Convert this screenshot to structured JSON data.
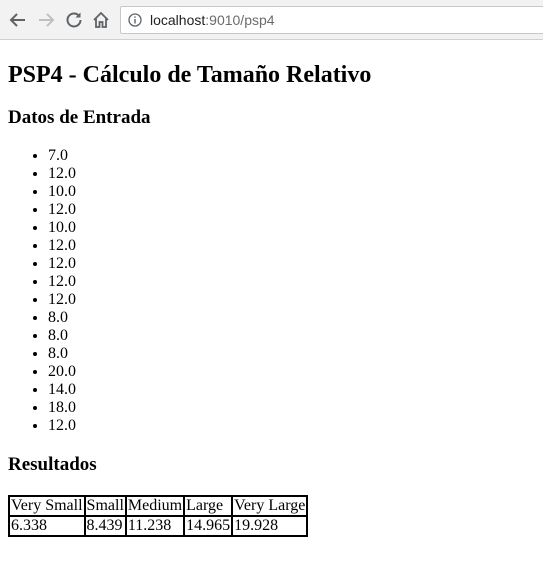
{
  "browser": {
    "url_host": "localhost",
    "url_rest": ":9010/psp4",
    "back_icon": "arrow-left-icon",
    "forward_icon": "arrow-right-icon",
    "reload_icon": "reload-icon",
    "home_icon": "home-icon",
    "info_icon": "info-icon"
  },
  "page": {
    "title": "PSP4 - Cálculo de Tamaño Relativo",
    "input_heading": "Datos de Entrada",
    "inputs": [
      "7.0",
      "12.0",
      "10.0",
      "12.0",
      "10.0",
      "12.0",
      "12.0",
      "12.0",
      "12.0",
      "8.0",
      "8.0",
      "8.0",
      "20.0",
      "14.0",
      "18.0",
      "12.0"
    ],
    "results_heading": "Resultados",
    "results_table": {
      "headers": [
        "Very Small",
        "Small",
        "Medium",
        "Large",
        "Very Large"
      ],
      "values": [
        "6.338",
        "8.439",
        "11.238",
        "14.965",
        "19.928"
      ]
    }
  }
}
